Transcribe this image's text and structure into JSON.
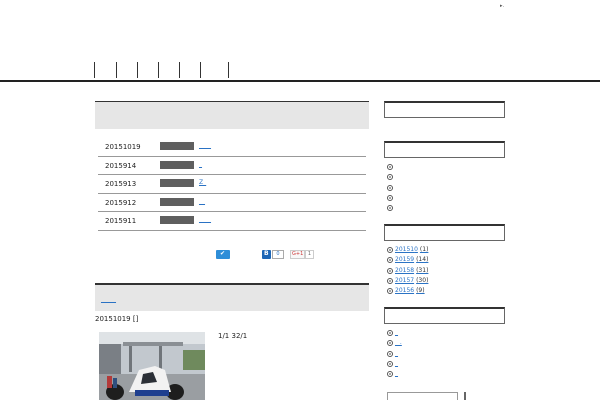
{
  "header": {
    "corner_mark": "▸.",
    "nav_item_count": 7
  },
  "news": {
    "rows": [
      {
        "date": "20151019",
        "link": "____"
      },
      {
        "date": "2015914",
        "link": "_"
      },
      {
        "date": "2015913",
        "link": "Z_"
      },
      {
        "date": "2015912",
        "link": "__"
      },
      {
        "date": "2015911",
        "link": "____"
      }
    ]
  },
  "share": {
    "twitter_icon": "twitter-bird-icon",
    "hatena_label": "B",
    "hatena_count": "0",
    "gplus_label": "G+1",
    "gplus_count": "1"
  },
  "post": {
    "title_link": "_____",
    "date": "20151019 []",
    "text": "1/1 32/1"
  },
  "sidebar": {
    "recent": [
      "",
      "",
      "",
      "",
      ""
    ],
    "archives": [
      {
        "label": "20151",
        "suffix": "0",
        "count": "(1)"
      },
      {
        "label": "20159",
        "suffix": "",
        "count": "(14)"
      },
      {
        "label": "20158",
        "suffix": "",
        "count": "(31)"
      },
      {
        "label": "20157",
        "suffix": "",
        "count": "(30)"
      },
      {
        "label": "20156",
        "suffix": "",
        "count": "(9)"
      }
    ],
    "categories": [
      "_",
      "_ .",
      "_",
      "_",
      "_"
    ]
  },
  "colors": {
    "link": "#2a73c5",
    "header_rule": "#222222",
    "box_head_bg": "#e6e6e6",
    "category_badge": "#5f5f5f",
    "twitter": "#2e8ed8",
    "hatena": "#1d66b6"
  }
}
